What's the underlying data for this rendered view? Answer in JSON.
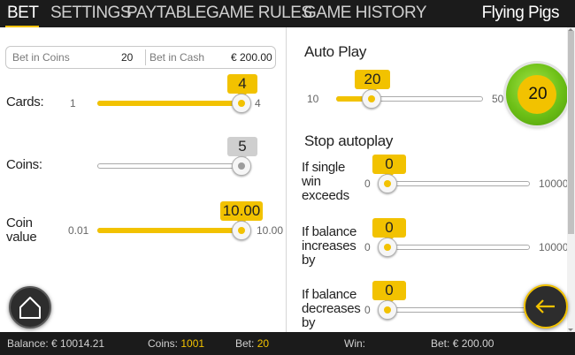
{
  "tabs": [
    {
      "label": "BET",
      "active": true
    },
    {
      "label": "SETTINGS"
    },
    {
      "label": "PAYTABLE"
    },
    {
      "label": "GAME RULES"
    },
    {
      "label": "GAME HISTORY"
    }
  ],
  "game_title": "Flying Pigs",
  "bet_box": {
    "coins_label": "Bet in Coins",
    "coins_value": "20",
    "cash_label": "Bet in Cash",
    "cash_value": "€ 200.00"
  },
  "sliders": {
    "cards": {
      "label": "Cards:",
      "min": "1",
      "max": "4",
      "value": "4",
      "fill_fraction": 1.0
    },
    "coins": {
      "label": "Coins:",
      "value": "5",
      "fill_fraction": 1.0
    },
    "coin_value": {
      "label": "Coin value",
      "min": "0.01",
      "max": "10.00",
      "value": "10.00",
      "fill_fraction": 1.0
    }
  },
  "auto_play": {
    "title": "Auto Play",
    "min": "10",
    "max": "50",
    "value": "20",
    "fill_fraction": 0.25,
    "play_count": "20"
  },
  "stop_autoplay": {
    "title": "Stop autoplay",
    "single_win": {
      "label": "If single win exceeds",
      "min": "0",
      "max": "10000",
      "value": "0",
      "fill_fraction": 0
    },
    "balance_increases": {
      "label": "If balance increases by",
      "min": "0",
      "max": "10000",
      "value": "0",
      "fill_fraction": 0
    },
    "balance_decreases": {
      "label": "If balance decreases by",
      "min": "0",
      "value": "0",
      "fill_fraction": 0
    }
  },
  "status": {
    "balance_label": "Balance:",
    "balance_value": "€ 10014.21",
    "coins_label": "Coins:",
    "coins_value": "1001",
    "bet_label": "Bet:",
    "bet_value": "20",
    "win_label": "Win:",
    "win_value": "",
    "bet_cash_label": "Bet:",
    "bet_cash_value": "€ 200.00"
  },
  "colors": {
    "accent": "#f2c200",
    "play_green": "#6cbf16",
    "bar": "#1b1b1b"
  },
  "icons": {
    "home": "home-icon",
    "back": "arrow-left-icon",
    "play": "play-icon"
  }
}
